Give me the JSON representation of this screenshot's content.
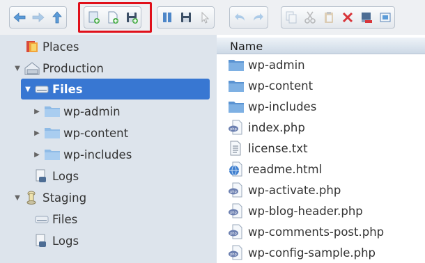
{
  "toolbar": {
    "groups": [
      [
        "back-icon",
        "forward-icon",
        "up-icon"
      ],
      [
        "new-folder-icon",
        "new-file-icon",
        "save-as-icon"
      ],
      [
        "bookmark-icon",
        "save-icon",
        "select-icon"
      ],
      [
        "undo-icon",
        "redo-icon"
      ],
      [
        "copy-icon",
        "cut-icon",
        "paste-icon",
        "delete-icon",
        "disconnect-icon",
        "properties-icon"
      ]
    ],
    "accent": "#e0101a"
  },
  "sidebar": {
    "items": [
      {
        "label": "Places",
        "icon": "places-icon"
      },
      {
        "label": "Production",
        "icon": "server-icon"
      },
      {
        "label": "Files",
        "icon": "drive-icon"
      },
      {
        "label": "wp-admin",
        "icon": "folder-icon"
      },
      {
        "label": "wp-content",
        "icon": "folder-icon"
      },
      {
        "label": "wp-includes",
        "icon": "folder-icon"
      },
      {
        "label": "Logs",
        "icon": "logs-icon"
      },
      {
        "label": "Staging",
        "icon": "staging-icon"
      },
      {
        "label": "Files",
        "icon": "drive-icon"
      },
      {
        "label": "Logs",
        "icon": "logs-icon"
      }
    ],
    "selected_color": "#3877d2"
  },
  "main": {
    "column_header": "Name",
    "files": [
      {
        "name": "wp-admin",
        "icon": "folder-icon"
      },
      {
        "name": "wp-content",
        "icon": "folder-icon"
      },
      {
        "name": "wp-includes",
        "icon": "folder-icon"
      },
      {
        "name": "index.php",
        "icon": "php-file-icon"
      },
      {
        "name": "license.txt",
        "icon": "text-file-icon"
      },
      {
        "name": "readme.html",
        "icon": "html-file-icon"
      },
      {
        "name": "wp-activate.php",
        "icon": "php-file-icon"
      },
      {
        "name": "wp-blog-header.php",
        "icon": "php-file-icon"
      },
      {
        "name": "wp-comments-post.php",
        "icon": "php-file-icon"
      },
      {
        "name": "wp-config-sample.php",
        "icon": "php-file-icon"
      }
    ]
  }
}
